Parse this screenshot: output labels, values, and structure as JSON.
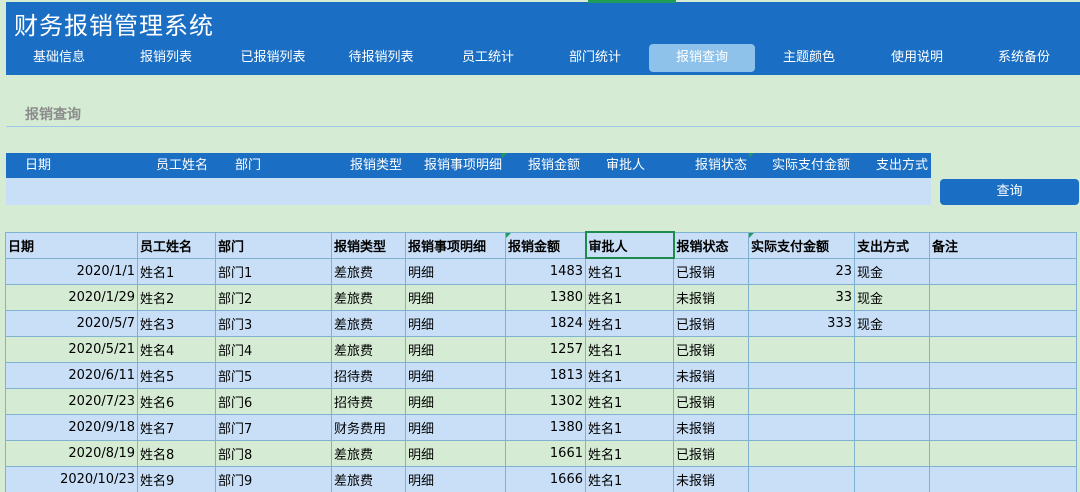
{
  "app": {
    "title": "财务报销管理系统"
  },
  "nav": {
    "items": [
      {
        "label": "基础信息"
      },
      {
        "label": "报销列表"
      },
      {
        "label": "已报销列表"
      },
      {
        "label": "待报销列表"
      },
      {
        "label": "员工统计"
      },
      {
        "label": "部门统计"
      },
      {
        "label": "报销查询",
        "active": true
      },
      {
        "label": "主题颜色"
      },
      {
        "label": "使用说明"
      },
      {
        "label": "系统备份"
      }
    ]
  },
  "query": {
    "section_title": "报销查询",
    "fields": [
      {
        "label": "日期"
      },
      {
        "label": "员工姓名"
      },
      {
        "label": "部门"
      },
      {
        "label": "报销类型"
      },
      {
        "label": "报销事项明细"
      },
      {
        "label": "报销金额"
      },
      {
        "label": "审批人"
      },
      {
        "label": "报销状态"
      },
      {
        "label": "实际支付金额"
      },
      {
        "label": "支出方式"
      }
    ],
    "button_label": "查询"
  },
  "table": {
    "columns": [
      "日期",
      "员工姓名",
      "部门",
      "报销类型",
      "报销事项明细",
      "报销金额",
      "审批人",
      "报销状态",
      "实际支付金额",
      "支出方式",
      "备注"
    ],
    "rows": [
      [
        "2020/1/1",
        "姓名1",
        "部门1",
        "差旅费",
        "明细",
        "1483",
        "姓名1",
        "已报销",
        "23",
        "现金",
        ""
      ],
      [
        "2020/1/29",
        "姓名2",
        "部门2",
        "差旅费",
        "明细",
        "1380",
        "姓名1",
        "未报销",
        "33",
        "现金",
        ""
      ],
      [
        "2020/5/7",
        "姓名3",
        "部门3",
        "差旅费",
        "明细",
        "1824",
        "姓名1",
        "已报销",
        "333",
        "现金",
        ""
      ],
      [
        "2020/5/21",
        "姓名4",
        "部门4",
        "差旅费",
        "明细",
        "1257",
        "姓名1",
        "已报销",
        "",
        "",
        ""
      ],
      [
        "2020/6/11",
        "姓名5",
        "部门5",
        "招待费",
        "明细",
        "1813",
        "姓名1",
        "未报销",
        "",
        "",
        ""
      ],
      [
        "2020/7/23",
        "姓名6",
        "部门6",
        "招待费",
        "明细",
        "1302",
        "姓名1",
        "已报销",
        "",
        "",
        ""
      ],
      [
        "2020/9/18",
        "姓名7",
        "部门7",
        "财务费用",
        "明细",
        "1380",
        "姓名1",
        "未报销",
        "",
        "",
        ""
      ],
      [
        "2020/8/19",
        "姓名8",
        "部门8",
        "差旅费",
        "明细",
        "1661",
        "姓名1",
        "已报销",
        "",
        "",
        ""
      ],
      [
        "2020/10/23",
        "姓名9",
        "部门9",
        "差旅费",
        "明细",
        "1666",
        "姓名1",
        "未报销",
        "",
        "",
        ""
      ]
    ]
  },
  "colors": {
    "header_blue": "#1a6fc4",
    "active_tab": "#8ec2ea",
    "row_blue": "#c9dff7",
    "row_green": "#d5ebd3",
    "selection_green": "#1e8a4c"
  }
}
